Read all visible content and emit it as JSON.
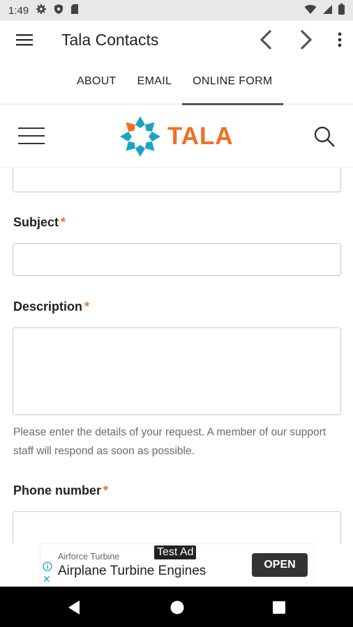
{
  "status_bar": {
    "time": "1:49"
  },
  "app_bar": {
    "title": "Tala Contacts"
  },
  "tabs": [
    {
      "label": "ABOUT"
    },
    {
      "label": "EMAIL"
    },
    {
      "label": "ONLINE FORM",
      "active": true
    }
  ],
  "site": {
    "logo_text": "TALA",
    "brand_color": "#f26e21",
    "logo_icon_color": "#1ba3c6"
  },
  "form": {
    "subject_label": "Subject",
    "description_label": "Description",
    "description_help": "Please enter the details of your request. A member of our support staff will respond as soon as possible.",
    "phone_label": "Phone number",
    "required_mark": "*"
  },
  "ad": {
    "badge": "Test Ad",
    "advertiser": "Airforce Turbine",
    "headline": "Airplane Turbine Engines",
    "cta": "OPEN",
    "close": "✕"
  }
}
